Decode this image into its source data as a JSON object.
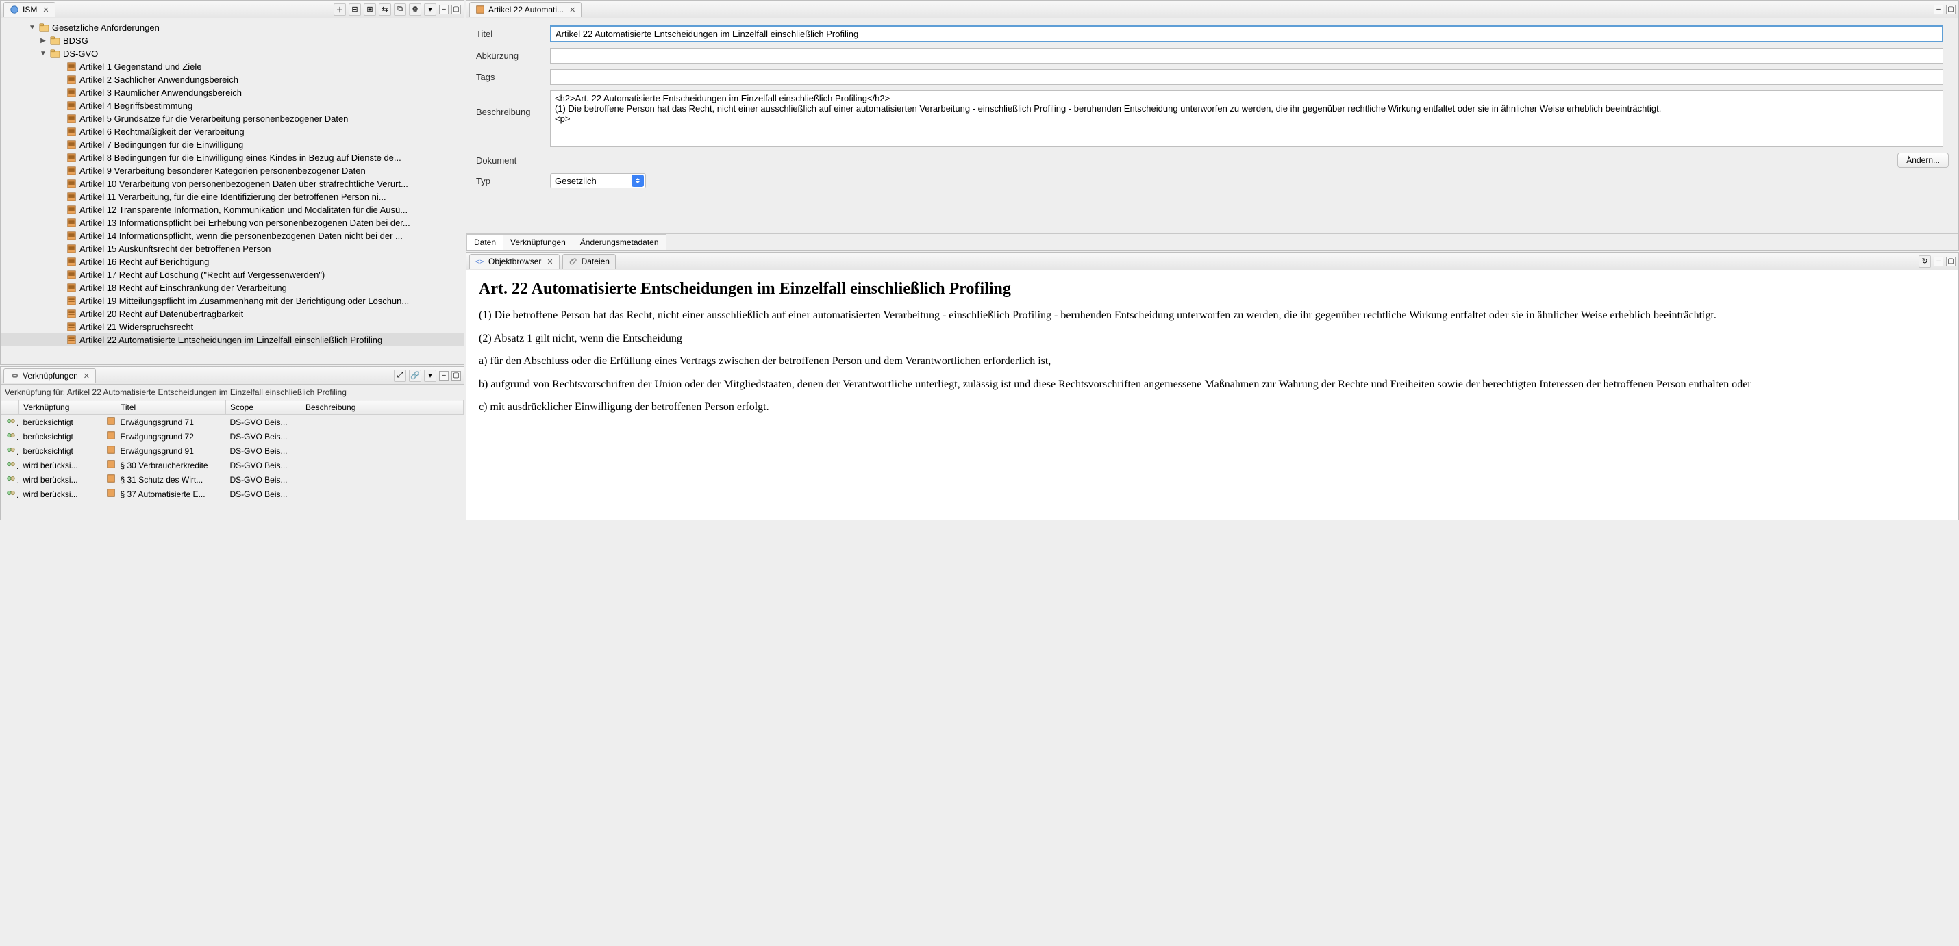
{
  "ism": {
    "tab_label": "ISM",
    "root_label": "Gesetzliche Anforderungen",
    "children": [
      {
        "label": "BDSG",
        "expanded": false
      },
      {
        "label": "DS-GVO",
        "expanded": true,
        "items": [
          "Artikel 1 Gegenstand und Ziele",
          "Artikel 2 Sachlicher Anwendungsbereich",
          "Artikel 3 Räumlicher Anwendungsbereich",
          "Artikel 4 Begriffsbestimmung",
          "Artikel 5 Grundsätze für die Verarbeitung personenbezogener Daten",
          "Artikel 6  Rechtmäßigkeit der Verarbeitung",
          "Artikel 7 Bedingungen für die Einwilligung",
          "Artikel 8 Bedingungen für die Einwilligung eines Kindes in Bezug auf Dienste de...",
          "Artikel 9 Verarbeitung besonderer Kategorien personenbezogener Daten",
          "Artikel 10 Verarbeitung von personenbezogenen Daten über strafrechtliche Verurt...",
          "Artikel 11 Verarbeitung, für die eine Identifizierung der betroffenen Person ni...",
          "Artikel 12 Transparente Information, Kommunikation und Modalitäten für die Ausü...",
          "Artikel 13 Informationspflicht bei Erhebung von personenbezogenen Daten bei der...",
          "Artikel 14 Informationspflicht, wenn die personenbezogenen Daten nicht bei der ...",
          "Artikel 15 Auskunftsrecht der betroffenen Person",
          "Artikel 16 Recht auf Berichtigung",
          "Artikel 17 Recht auf Löschung (\"Recht auf Vergessenwerden\")",
          "Artikel 18 Recht auf Einschränkung der Verarbeitung",
          "Artikel 19 Mitteilungspflicht im Zusammenhang mit der Berichtigung oder Löschun...",
          "Artikel 20 Recht auf Datenübertragbarkeit",
          "Artikel 21 Widerspruchsrecht",
          "Artikel 22 Automatisierte Entscheidungen im Einzelfall einschließlich Profiling"
        ]
      }
    ],
    "selected_index": 21
  },
  "links_panel": {
    "tab_label": "Verknüpfungen",
    "context_prefix": "Verknüpfung für: ",
    "context_subject": "Artikel 22 Automatisierte Entscheidungen im Einzelfall einschließlich Profiling",
    "columns": [
      "Verknüpfung",
      "Titel",
      "Scope",
      "Beschreibung"
    ],
    "rows": [
      {
        "link": "berücksichtigt",
        "title": "Erwägungsgrund 71",
        "scope": "DS-GVO Beis...",
        "desc": ""
      },
      {
        "link": "berücksichtigt",
        "title": "Erwägungsgrund 72",
        "scope": "DS-GVO Beis...",
        "desc": ""
      },
      {
        "link": "berücksichtigt",
        "title": "Erwägungsgrund 91",
        "scope": "DS-GVO Beis...",
        "desc": ""
      },
      {
        "link": "wird berücksi...",
        "title": "§ 30 Verbraucherkredite",
        "scope": "DS-GVO Beis...",
        "desc": ""
      },
      {
        "link": "wird berücksi...",
        "title": "§ 31 Schutz des Wirt...",
        "scope": "DS-GVO Beis...",
        "desc": ""
      },
      {
        "link": "wird berücksi...",
        "title": "§ 37 Automatisierte E...",
        "scope": "DS-GVO Beis...",
        "desc": ""
      }
    ]
  },
  "editor": {
    "tab_label": "Artikel 22 Automati...",
    "fields": {
      "titel_label": "Titel",
      "titel_value": "Artikel 22 Automatisierte Entscheidungen im Einzelfall einschließlich Profiling",
      "abk_label": "Abkürzung",
      "abk_value": "",
      "tags_label": "Tags",
      "tags_value": "",
      "beschr_label": "Beschreibung",
      "beschr_value": "<h2>Art. 22 Automatisierte Entscheidungen im Einzelfall einschließlich Profiling</h2>\n(1) Die betroffene Person hat das Recht, nicht einer ausschließlich auf einer automatisierten Verarbeitung - einschließlich Profiling - beruhenden Entscheidung unterworfen zu werden, die ihr gegenüber rechtliche Wirkung entfaltet oder sie in ähnlicher Weise erheblich beeinträchtigt.\n<p>",
      "dokument_label": "Dokument",
      "aendern_label": "Ändern...",
      "typ_label": "Typ",
      "typ_value": "Gesetzlich"
    },
    "bottom_tabs": [
      "Daten",
      "Verknüpfungen",
      "Änderungsmetadaten"
    ],
    "bottom_active": 0
  },
  "object_browser": {
    "tab_label": "Objektbrowser",
    "files_tab_label": "Dateien",
    "heading": "Art. 22 Automatisierte Entscheidungen im Einzelfall einschließlich Profiling",
    "paragraphs": [
      "(1) Die betroffene Person hat das Recht, nicht einer ausschließlich auf einer automatisierten Verarbeitung - einschließlich Profiling - beruhenden Entscheidung unterworfen zu werden, die ihr gegenüber rechtliche Wirkung entfaltet oder sie in ähnlicher Weise erheblich beeinträchtigt.",
      "(2) Absatz 1 gilt nicht, wenn die Entscheidung",
      "a) für den Abschluss oder die Erfüllung eines Vertrags zwischen der betroffenen Person und dem Verantwortlichen erforderlich ist,",
      "b) aufgrund von Rechtsvorschriften der Union oder der Mitgliedstaaten, denen der Verantwortliche unterliegt, zulässig ist und diese Rechtsvorschriften angemessene Maßnahmen zur Wahrung der Rechte und Freiheiten sowie der berechtigten Interessen der betroffenen Person enthalten oder",
      "c) mit ausdrücklicher Einwilligung der betroffenen Person erfolgt."
    ]
  }
}
